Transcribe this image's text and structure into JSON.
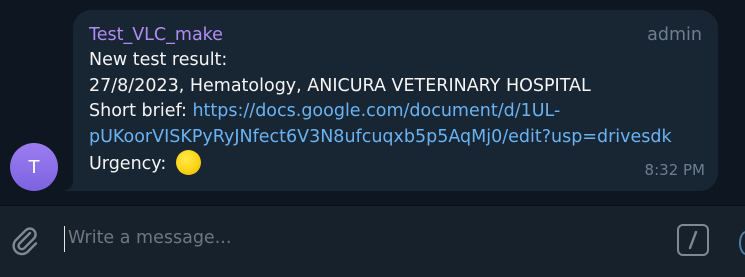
{
  "message": {
    "avatar_letter": "T",
    "sender": "Test_VLC_make",
    "role": "admin",
    "lines": [
      "New test result:",
      "27/8/2023, Hematology, ANICURA VETERINARY HOSPITAL"
    ],
    "brief_label": "Short brief: ",
    "link_line1": "https://docs.google.com/document/d/1UL-",
    "link_line2": "pUKoorVISKPyRyJNfect6V3N8ufcuqxb5p5AqMj0/edit?usp=drivesdk",
    "urgency_label": "Urgency: ",
    "urgency_emoji": "yellow-circle",
    "time": "8:32 PM"
  },
  "composer": {
    "placeholder": "Write a message...",
    "attach_icon": "paperclip-icon",
    "commands_icon": "bot-commands-icon"
  },
  "colors": {
    "background": "#0e1621",
    "bubble": "#182533",
    "sender": "#b18cf5",
    "link": "#6ab3f3",
    "muted": "#6d7f90"
  }
}
